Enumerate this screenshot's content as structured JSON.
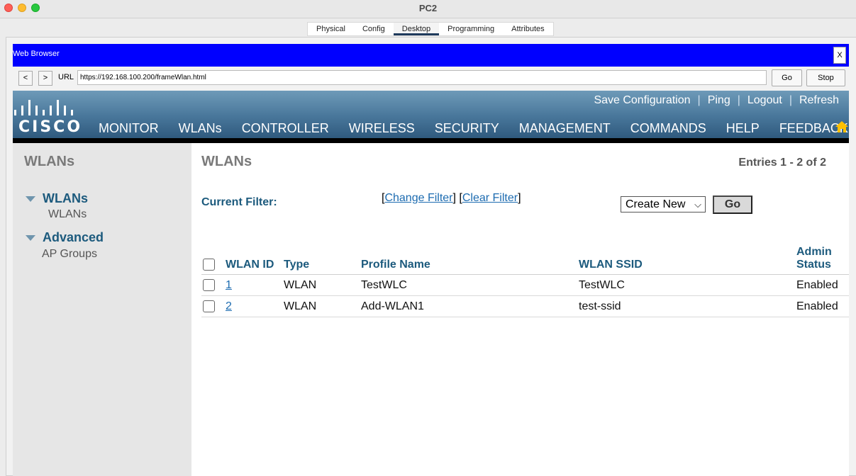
{
  "window": {
    "title": "PC2"
  },
  "pt_tabs": [
    "Physical",
    "Config",
    "Desktop",
    "Programming",
    "Attributes"
  ],
  "pt_active_tab": "Desktop",
  "browser": {
    "title": "Web Browser",
    "close_label": "X",
    "back_label": "<",
    "forward_label": ">",
    "url_label": "URL",
    "url": "https://192.168.100.200/frameWlan.html",
    "go_label": "Go",
    "stop_label": "Stop"
  },
  "cisco": {
    "logo_text": "CISCO",
    "top_links": [
      "Save Configuration",
      "Ping",
      "Logout",
      "Refresh"
    ],
    "nav": [
      "MONITOR",
      "WLANs",
      "CONTROLLER",
      "WIRELESS",
      "SECURITY",
      "MANAGEMENT",
      "COMMANDS",
      "HELP",
      "FEEDBACK"
    ],
    "nav_active": "WLANs",
    "accent_color": "#ff9900"
  },
  "sidebar": {
    "title": "WLANs",
    "groups": [
      {
        "label": "WLANs",
        "items": [
          "WLANs"
        ]
      },
      {
        "label": "Advanced",
        "items": [
          "AP Groups"
        ]
      }
    ]
  },
  "main": {
    "title": "WLANs",
    "entries": "Entries 1 - 2 of 2",
    "filter_label": "Current Filter:",
    "change_filter": "Change Filter",
    "clear_filter": "Clear Filter",
    "create_select": "Create New",
    "go_label": "Go",
    "columns": [
      "WLAN ID",
      "Type",
      "Profile Name",
      "WLAN SSID",
      "Admin Status"
    ],
    "rows": [
      {
        "id": "1",
        "type": "WLAN",
        "profile": "TestWLC",
        "ssid": "TestWLC",
        "status": "Enabled"
      },
      {
        "id": "2",
        "type": "WLAN",
        "profile": "Add-WLAN1",
        "ssid": "test-ssid",
        "status": "Enabled"
      }
    ]
  }
}
